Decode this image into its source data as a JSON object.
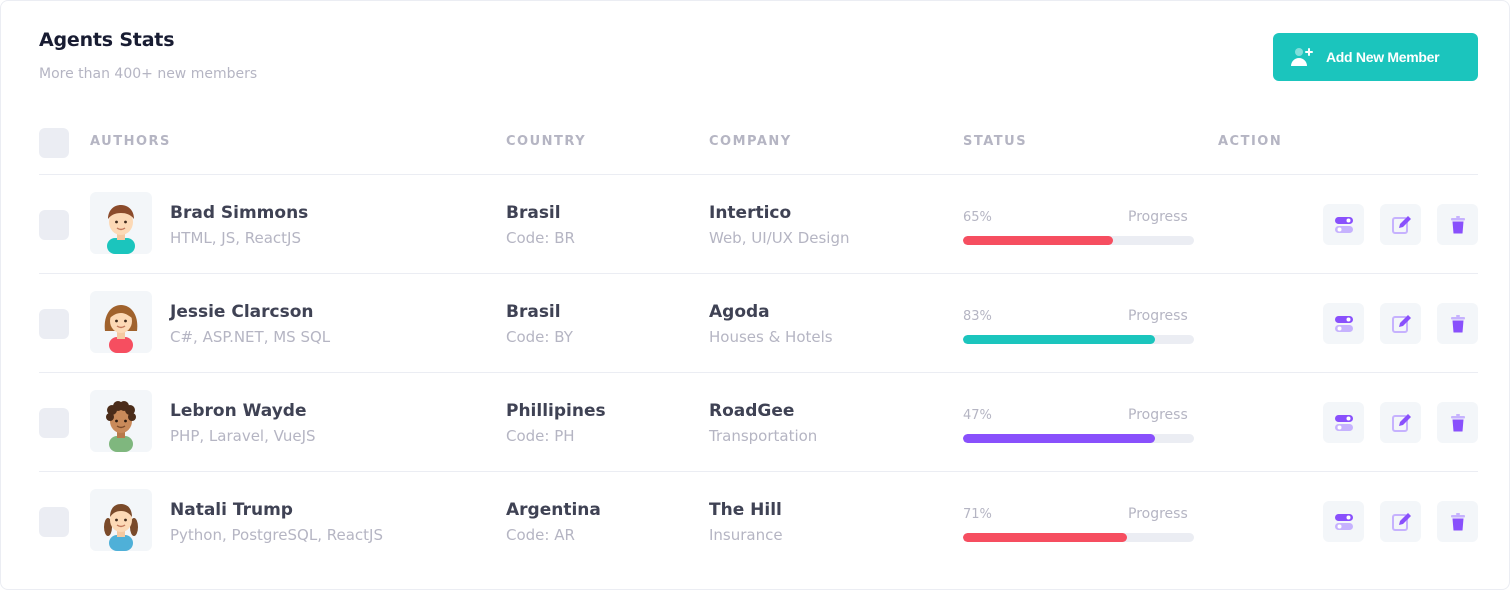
{
  "header": {
    "title": "Agents Stats",
    "subtitle": "More than 400+ new members",
    "add_button_label": "Add New Member"
  },
  "columns": [
    "AUTHORS",
    "COUNTRY",
    "COMPANY",
    "STATUS",
    "ACTION"
  ],
  "accent_colors": {
    "teal": "#1bc5bd",
    "red": "#f64e60",
    "purple": "#8950fc",
    "icon": "#8950fc"
  },
  "rows": [
    {
      "name": "Brad Simmons",
      "skills": "HTML, JS, ReactJS",
      "country": "Brasil",
      "country_code": "Code: BR",
      "company": "Intertico",
      "company_type": "Web, UI/UX Design",
      "progress_text": "65%",
      "progress_label": "Progress",
      "progress_color": "#f64e60",
      "avatar": "boy-avatar"
    },
    {
      "name": "Jessie Clarcson",
      "skills": "C#, ASP.NET, MS SQL",
      "country": "Brasil",
      "country_code": "Code: BY",
      "company": "Agoda",
      "company_type": "Houses & Hotels",
      "progress_text": "83%",
      "progress_label": "Progress",
      "progress_color": "#1bc5bd",
      "avatar": "girl-avatar"
    },
    {
      "name": "Lebron Wayde",
      "skills": "PHP, Laravel, VueJS",
      "country": "Phillipines",
      "country_code": "Code: PH",
      "company": "RoadGee",
      "company_type": "Transportation",
      "progress_text": "47%",
      "progress_label": "Progress",
      "progress_color": "#8950fc",
      "avatar": "curly-hair-avatar"
    },
    {
      "name": "Natali Trump",
      "skills": "Python, PostgreSQL, ReactJS",
      "country": "Argentina",
      "country_code": "Code: AR",
      "company": "The Hill",
      "company_type": "Insurance",
      "progress_text": "71%",
      "progress_label": "Progress",
      "progress_color": "#f64e60",
      "avatar": "braids-avatar"
    }
  ],
  "progress_fill": [
    0.65,
    0.83,
    0.83,
    0.71
  ],
  "action_icons": [
    "toggle-icon",
    "edit-icon",
    "trash-icon"
  ]
}
